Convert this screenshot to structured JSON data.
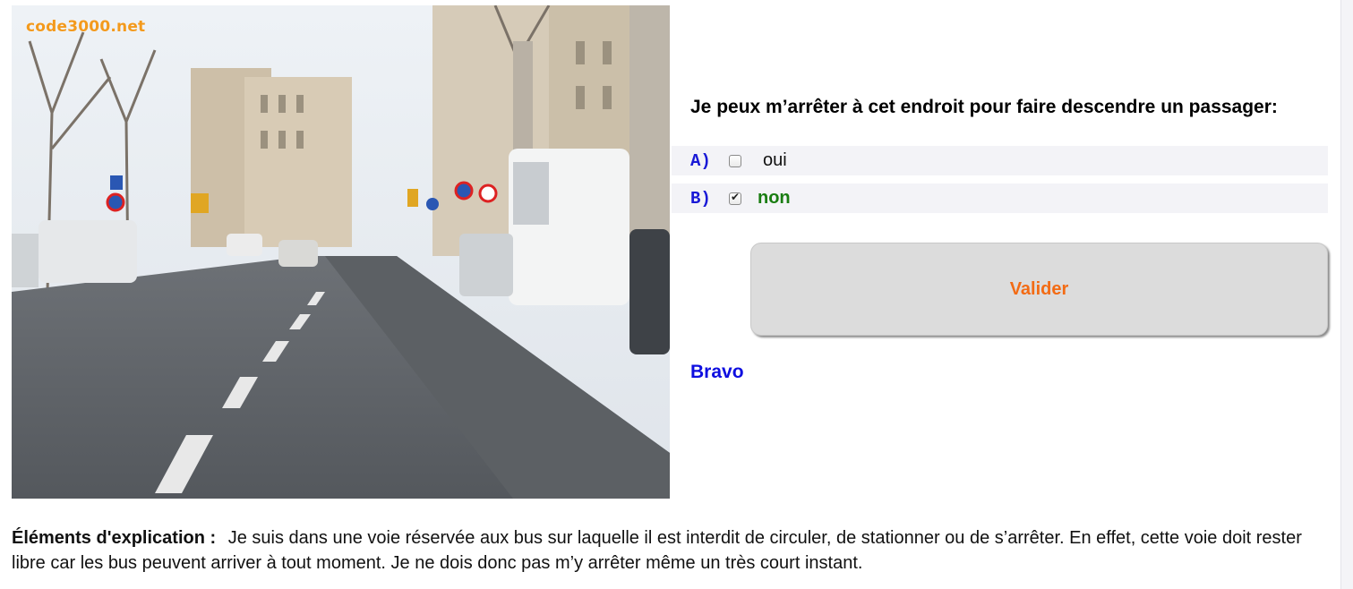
{
  "photo": {
    "watermark": "code3000.net",
    "alt": "road scene"
  },
  "question": {
    "text": "Je peux m’arrêter à cet endroit pour faire descendre un passager:"
  },
  "answers": [
    {
      "letter": "A)",
      "text": "oui",
      "checked": false
    },
    {
      "letter": "B)",
      "text": "non",
      "checked": true
    }
  ],
  "validate_button": {
    "label": "Valider"
  },
  "feedback": {
    "text": "Bravo"
  },
  "explanation": {
    "label": "Éléments d'explication :",
    "text": "Je suis dans une voie réservée aux bus sur laquelle il est interdit de circuler, de stationner ou de s’arrêter. En effet, cette voie doit rester libre car les bus peuvent arriver à tout moment. Je ne dois donc pas m’y arrêter même un très court instant."
  },
  "colors": {
    "answer_letter": "#1919d6",
    "correct_answer": "#1a7d12",
    "button_text": "#f36b14",
    "feedback": "#0e0ee0",
    "watermark": "#f39a1d"
  }
}
